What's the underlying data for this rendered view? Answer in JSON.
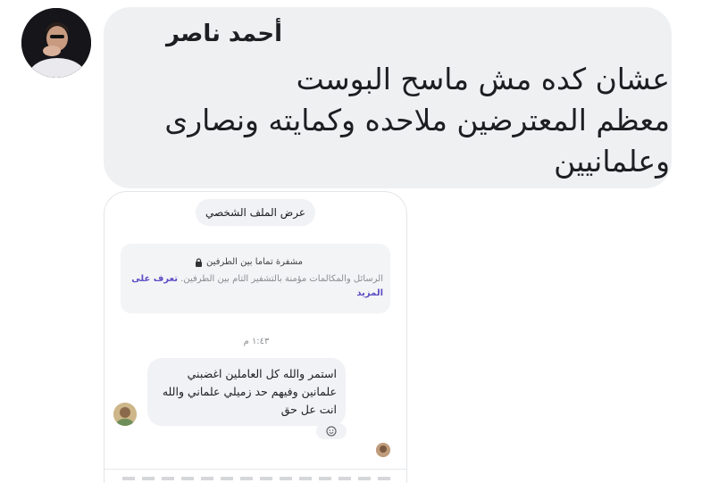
{
  "comment": {
    "author": "أحمد ناصر",
    "lines": [
      "عشان كده مش ماسح البوست",
      "معظم المعترضين ملاحده وكمايته ونصارى",
      "وعلمانيين"
    ]
  },
  "screenshot": {
    "profile_button": "عرض الملف الشخصي",
    "encryption": {
      "title": "مشفرة تماما بين الطرفين",
      "description": "الرسائل والمكالمات مؤمنة بالتشفير التام بين الطرفين.",
      "learn_more": "تعرف على المزيد"
    },
    "timestamp": "١:٤٣ م",
    "message": {
      "lines": [
        "استمر والله كل العاملين اغضبني",
        "علمانين وفيهم حد زميلي علماني والله",
        "انت عل حق"
      ]
    }
  }
}
